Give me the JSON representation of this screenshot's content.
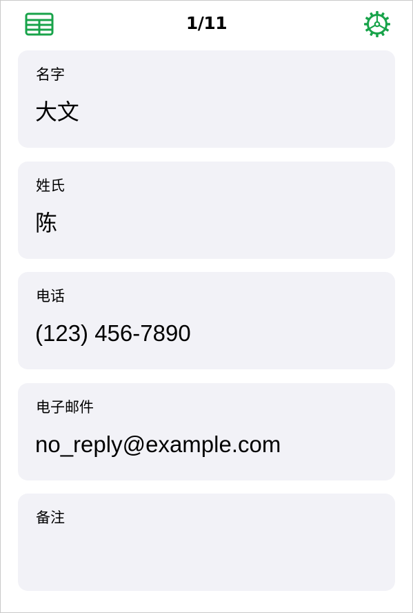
{
  "colors": {
    "accent": "#18a34a",
    "card_background": "#f2f2f7"
  },
  "toolbar": {
    "left_icon": "table-icon",
    "page_indicator": "1/11",
    "right_icon": "settings-gear-icon"
  },
  "fields": [
    {
      "label": "名字",
      "value": "大文"
    },
    {
      "label": "姓氏",
      "value": "陈"
    },
    {
      "label": "电话",
      "value": "(123) 456-7890"
    },
    {
      "label": "电子邮件",
      "value": "no_reply@example.com"
    },
    {
      "label": "备注",
      "value": ""
    }
  ]
}
